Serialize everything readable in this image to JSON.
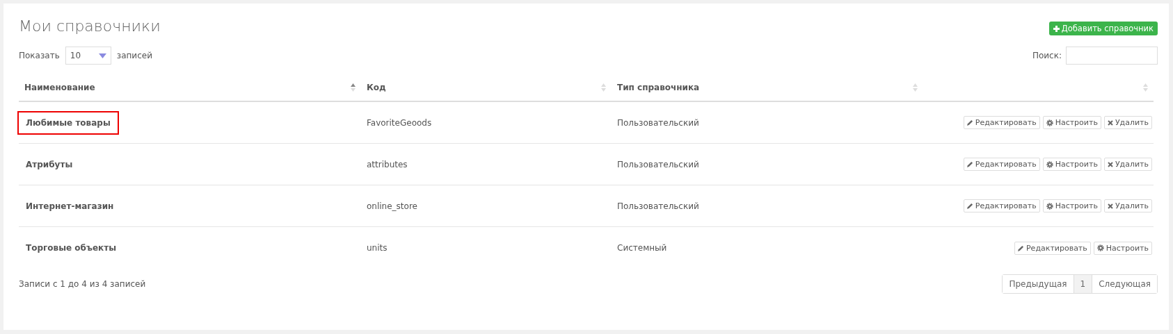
{
  "title": "Мои справочники",
  "add_button": {
    "label": "Добавить справочник"
  },
  "length": {
    "prefix": "Показать",
    "value": "10",
    "suffix": "записей"
  },
  "search": {
    "label": "Поиск:"
  },
  "table": {
    "columns": [
      {
        "label": "Наименование",
        "sorted": true
      },
      {
        "label": "Код",
        "sorted": false
      },
      {
        "label": "Тип справочника",
        "sorted": false
      },
      {
        "sorted": false
      }
    ],
    "rows": [
      {
        "name": "Любимые товары",
        "code": "FavoriteGeoods",
        "type": "Пользовательский",
        "highlighted": true,
        "actions": [
          {
            "kind": "edit",
            "label": "Редактировать"
          },
          {
            "kind": "configure",
            "label": "Настроить"
          },
          {
            "kind": "delete",
            "label": "Удалить"
          }
        ]
      },
      {
        "name": "Атрибуты",
        "code": "attributes",
        "type": "Пользовательский",
        "highlighted": false,
        "actions": [
          {
            "kind": "edit",
            "label": "Редактировать"
          },
          {
            "kind": "configure",
            "label": "Настроить"
          },
          {
            "kind": "delete",
            "label": "Удалить"
          }
        ]
      },
      {
        "name": "Интернет-магазин",
        "code": "online_store",
        "type": "Пользовательский",
        "highlighted": false,
        "actions": [
          {
            "kind": "edit",
            "label": "Редактировать"
          },
          {
            "kind": "configure",
            "label": "Настроить"
          },
          {
            "kind": "delete",
            "label": "Удалить"
          }
        ]
      },
      {
        "name": "Торговые объекты",
        "code": "units",
        "type": "Системный",
        "highlighted": false,
        "actions": [
          {
            "kind": "edit",
            "label": "Редактировать"
          },
          {
            "kind": "configure",
            "label": "Настроить"
          }
        ]
      }
    ]
  },
  "info": "Записи с 1 до 4 из 4 записей",
  "pagination": [
    {
      "label": "Предыдущая",
      "selected": false
    },
    {
      "label": "1",
      "selected": true
    },
    {
      "label": "Следующая",
      "selected": false
    }
  ]
}
